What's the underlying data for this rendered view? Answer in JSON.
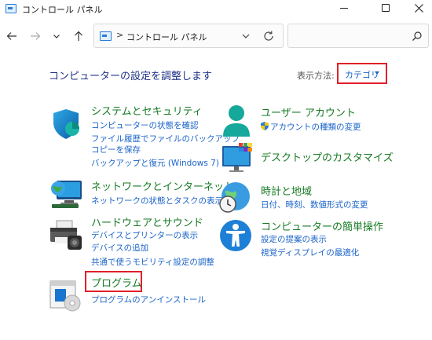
{
  "window": {
    "title": "コントロール パネル"
  },
  "nav": {
    "breadcrumb_separator": ">",
    "address_text": "コントロール パネル",
    "search_placeholder": ""
  },
  "header": {
    "title": "コンピューターの設定を調整します",
    "view_by_label": "表示方法:",
    "view_by_value": "カテゴリ"
  },
  "categories": {
    "system": {
      "title": "システムとセキュリティ",
      "links": [
        "コンピューターの状態を確認",
        "ファイル履歴でファイルのバックアップ",
        "コピーを保存",
        "バックアップと復元 (Windows 7)"
      ]
    },
    "network": {
      "title": "ネットワークとインターネット",
      "links": [
        "ネットワークの状態とタスクの表示"
      ]
    },
    "hardware": {
      "title": "ハードウェアとサウンド",
      "links": [
        "デバイスとプリンターの表示",
        "デバイスの追加",
        "共通で使うモビリティ設定の調整"
      ]
    },
    "programs": {
      "title": "プログラム",
      "links": [
        "プログラムのアンインストール"
      ]
    },
    "user": {
      "title": "ユーザー アカウント",
      "links": [
        "アカウントの種類の変更"
      ]
    },
    "appearance": {
      "title": "デスクトップのカスタマイズ",
      "links": []
    },
    "clock": {
      "title": "時計と地域",
      "links": [
        "日付、時刻、数値形式の変更"
      ]
    },
    "ease": {
      "title": "コンピューターの簡単操作",
      "links": [
        "設定の提案の表示",
        "視覚ディスプレイの最適化"
      ]
    }
  },
  "colors": {
    "category_title": "#157a23",
    "link": "#1a63c8",
    "page_title": "#1e3287",
    "highlight_box": "#e0202a"
  },
  "icons": [
    "control-panel-icon",
    "back-arrow-icon",
    "forward-arrow-icon",
    "chevron-down-icon",
    "up-arrow-icon",
    "refresh-icon",
    "search-icon",
    "shield-icon",
    "network-icon",
    "printer-icon",
    "programs-icon",
    "user-icon",
    "desktop-icon",
    "clock-globe-icon",
    "accessibility-icon"
  ]
}
